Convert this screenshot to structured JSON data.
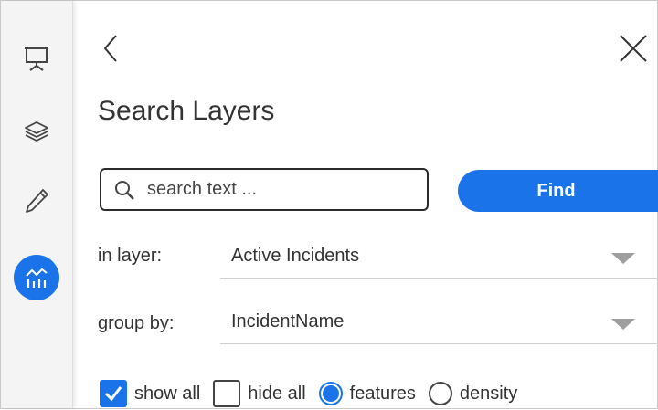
{
  "rail": {
    "items": [
      {
        "icon": "presentation-icon",
        "active": false
      },
      {
        "icon": "layers-icon",
        "active": false
      },
      {
        "icon": "pencil-icon",
        "active": false
      },
      {
        "icon": "analytics-icon",
        "active": true
      }
    ]
  },
  "panel": {
    "title": "Search Layers",
    "search": {
      "value": "",
      "placeholder": "search text ..."
    },
    "find_label": "Find",
    "layer": {
      "label": "in layer:",
      "value": "Active Incidents"
    },
    "group": {
      "label": "group by:",
      "value": "IncidentName"
    },
    "options": {
      "show_all": {
        "label": "show all",
        "checked": true
      },
      "hide_all": {
        "label": "hide all",
        "checked": false
      },
      "features": {
        "label": "features",
        "selected": true
      },
      "density": {
        "label": "density",
        "selected": false
      }
    }
  },
  "colors": {
    "accent": "#1a73e8",
    "text": "#333333",
    "rail_bg": "#f4f4f4"
  }
}
